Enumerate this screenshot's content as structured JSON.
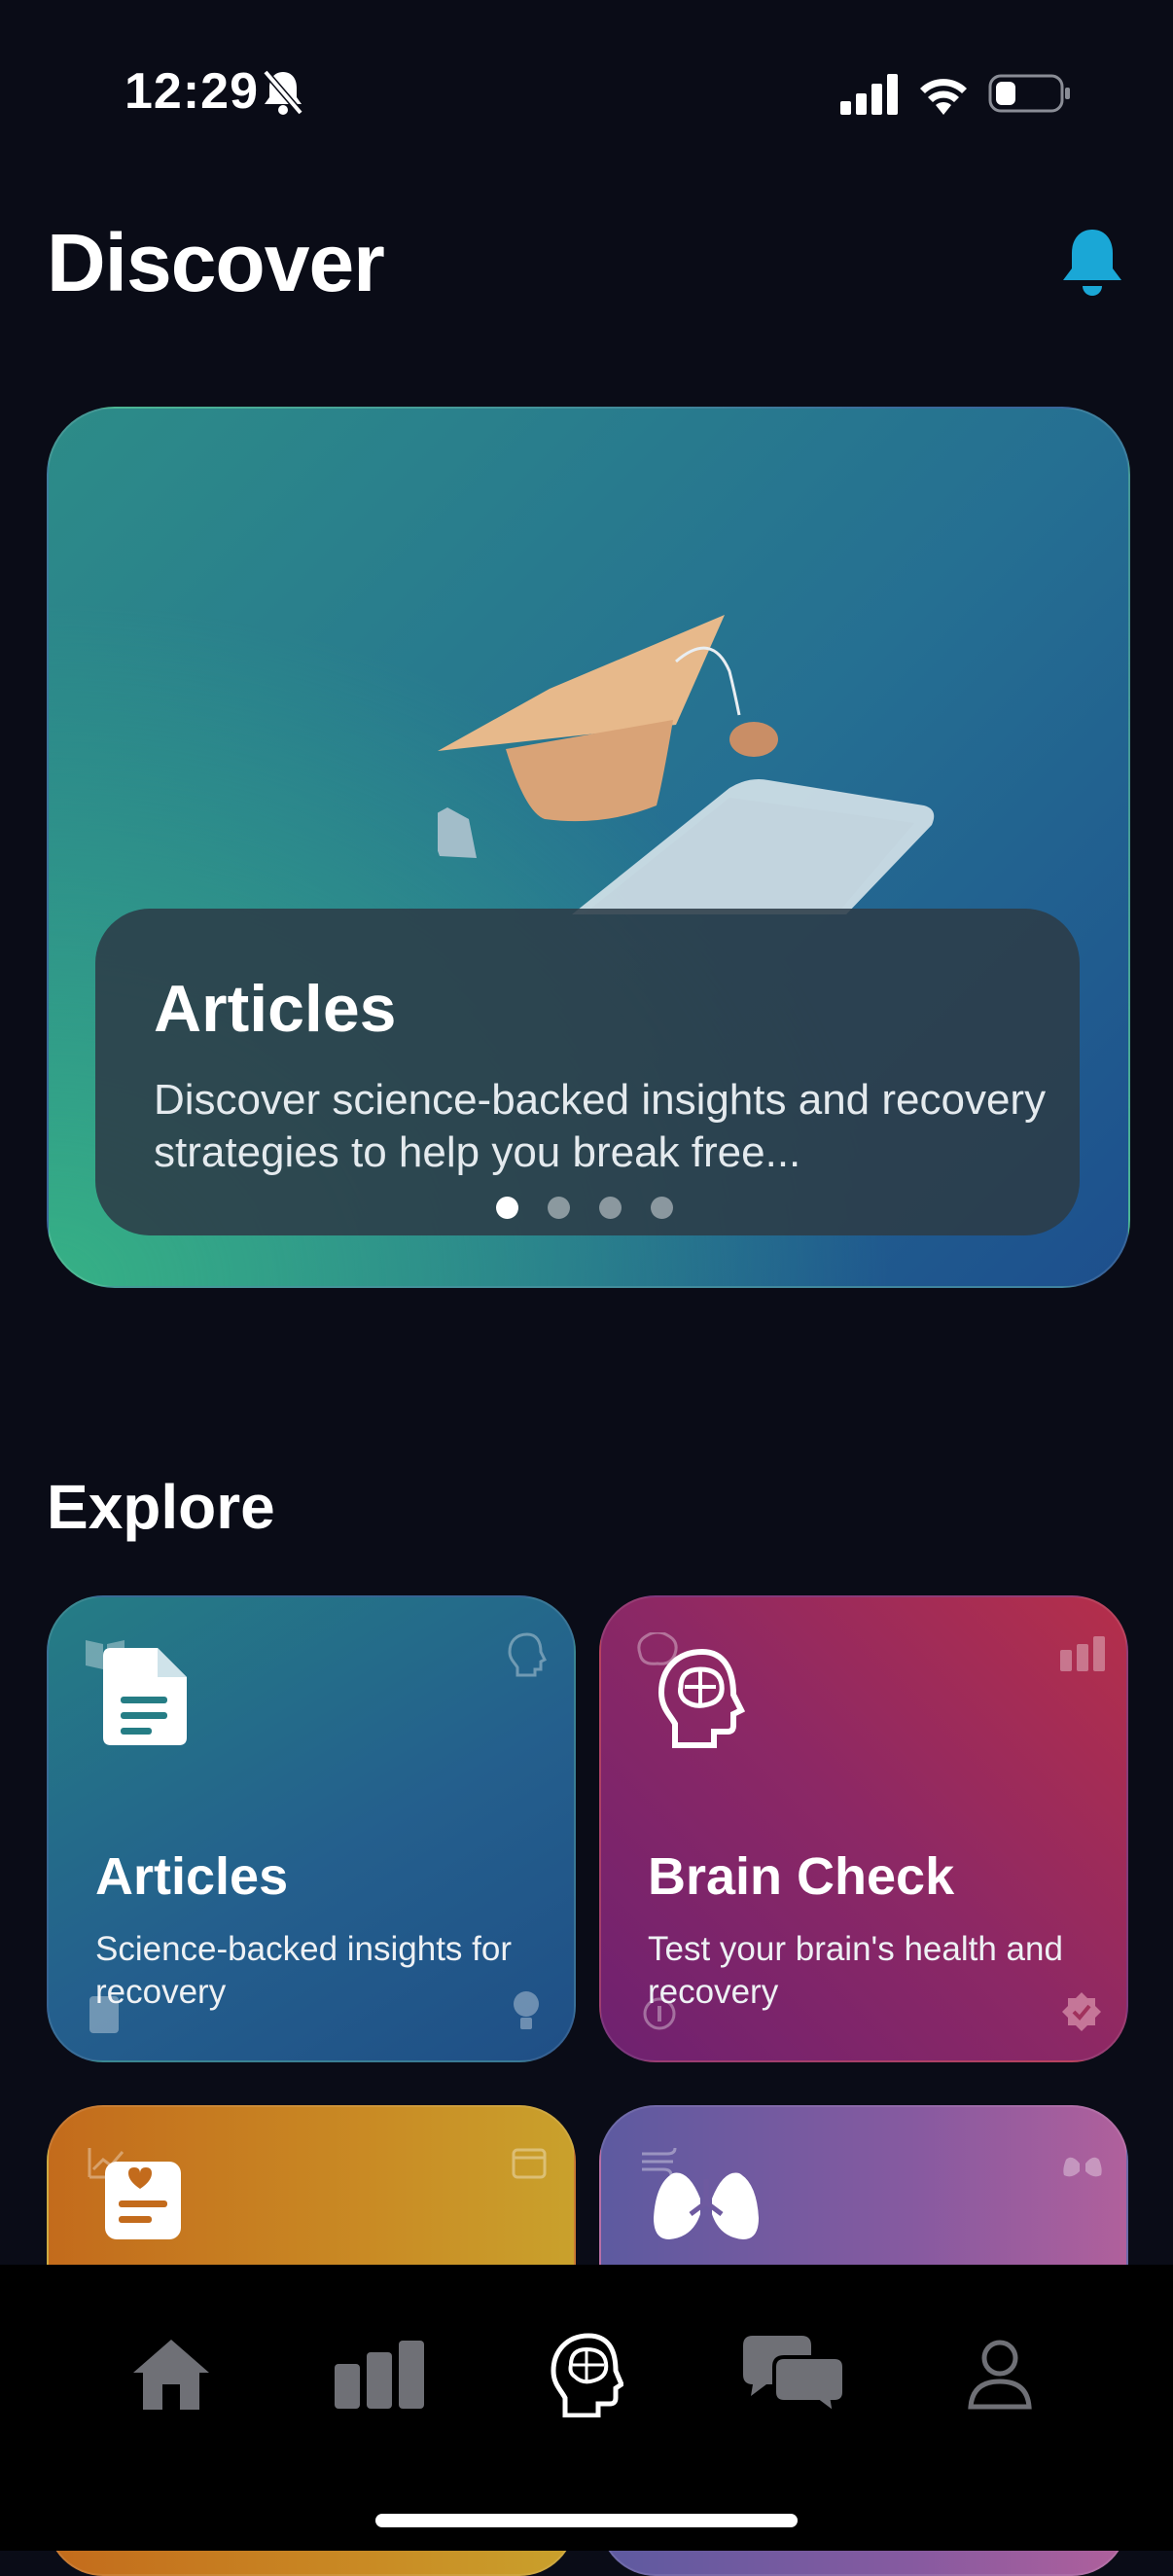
{
  "status_bar": {
    "time": "12:29",
    "icons": [
      "bell-slash-icon",
      "cellular-signal-icon",
      "wifi-icon",
      "battery-icon"
    ]
  },
  "header": {
    "title": "Discover",
    "bell_icon": "bell-icon",
    "accent_color": "#1aa7d6"
  },
  "hero": {
    "title": "Articles",
    "description": "Discover science-backed insights and recovery strategies to help you break free...",
    "illustration": "graduation-cap-and-book",
    "pages": 4,
    "active_page": 1
  },
  "explore": {
    "title": "Explore",
    "tiles": [
      {
        "title": "Articles",
        "description": "Science-backed insights for recovery",
        "icon": "document-icon"
      },
      {
        "title": "Brain Check",
        "description": "Test your brain's health and recovery",
        "icon": "brain-head-icon"
      },
      {
        "title": "",
        "description": "",
        "icon": "journal-heart-icon"
      },
      {
        "title": "",
        "description": "",
        "icon": "lungs-icon"
      }
    ]
  },
  "tab_bar": {
    "items": [
      {
        "name": "home",
        "icon": "house-icon",
        "active": false
      },
      {
        "name": "stats",
        "icon": "bar-chart-icon",
        "active": false
      },
      {
        "name": "discover",
        "icon": "brain-head-icon",
        "active": true
      },
      {
        "name": "community",
        "icon": "chat-bubbles-icon",
        "active": false
      },
      {
        "name": "profile",
        "icon": "person-icon",
        "active": false
      }
    ]
  }
}
